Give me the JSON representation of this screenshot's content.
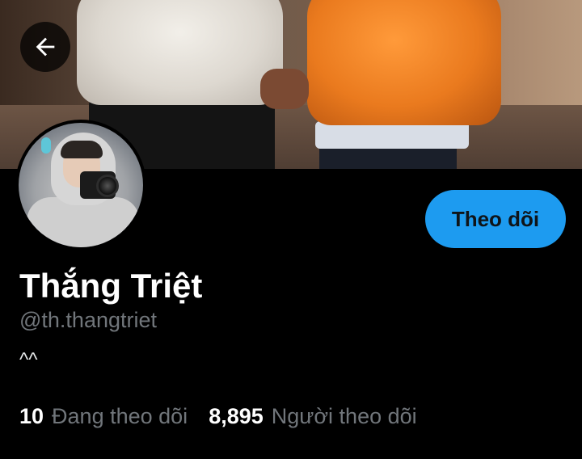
{
  "profile": {
    "name": "Thắng Triệt",
    "handle": "@th.thangtriet",
    "bio": "^^",
    "follow_label": "Theo dõi"
  },
  "stats": {
    "following_count": "10",
    "following_label": "Đang theo dõi",
    "followers_count": "8,895",
    "followers_label": "Người theo dõi"
  },
  "icons": {
    "back": "arrow-left-icon"
  },
  "colors": {
    "accent": "#1d9bf0",
    "background": "#000000",
    "secondary_text": "#71767b"
  }
}
